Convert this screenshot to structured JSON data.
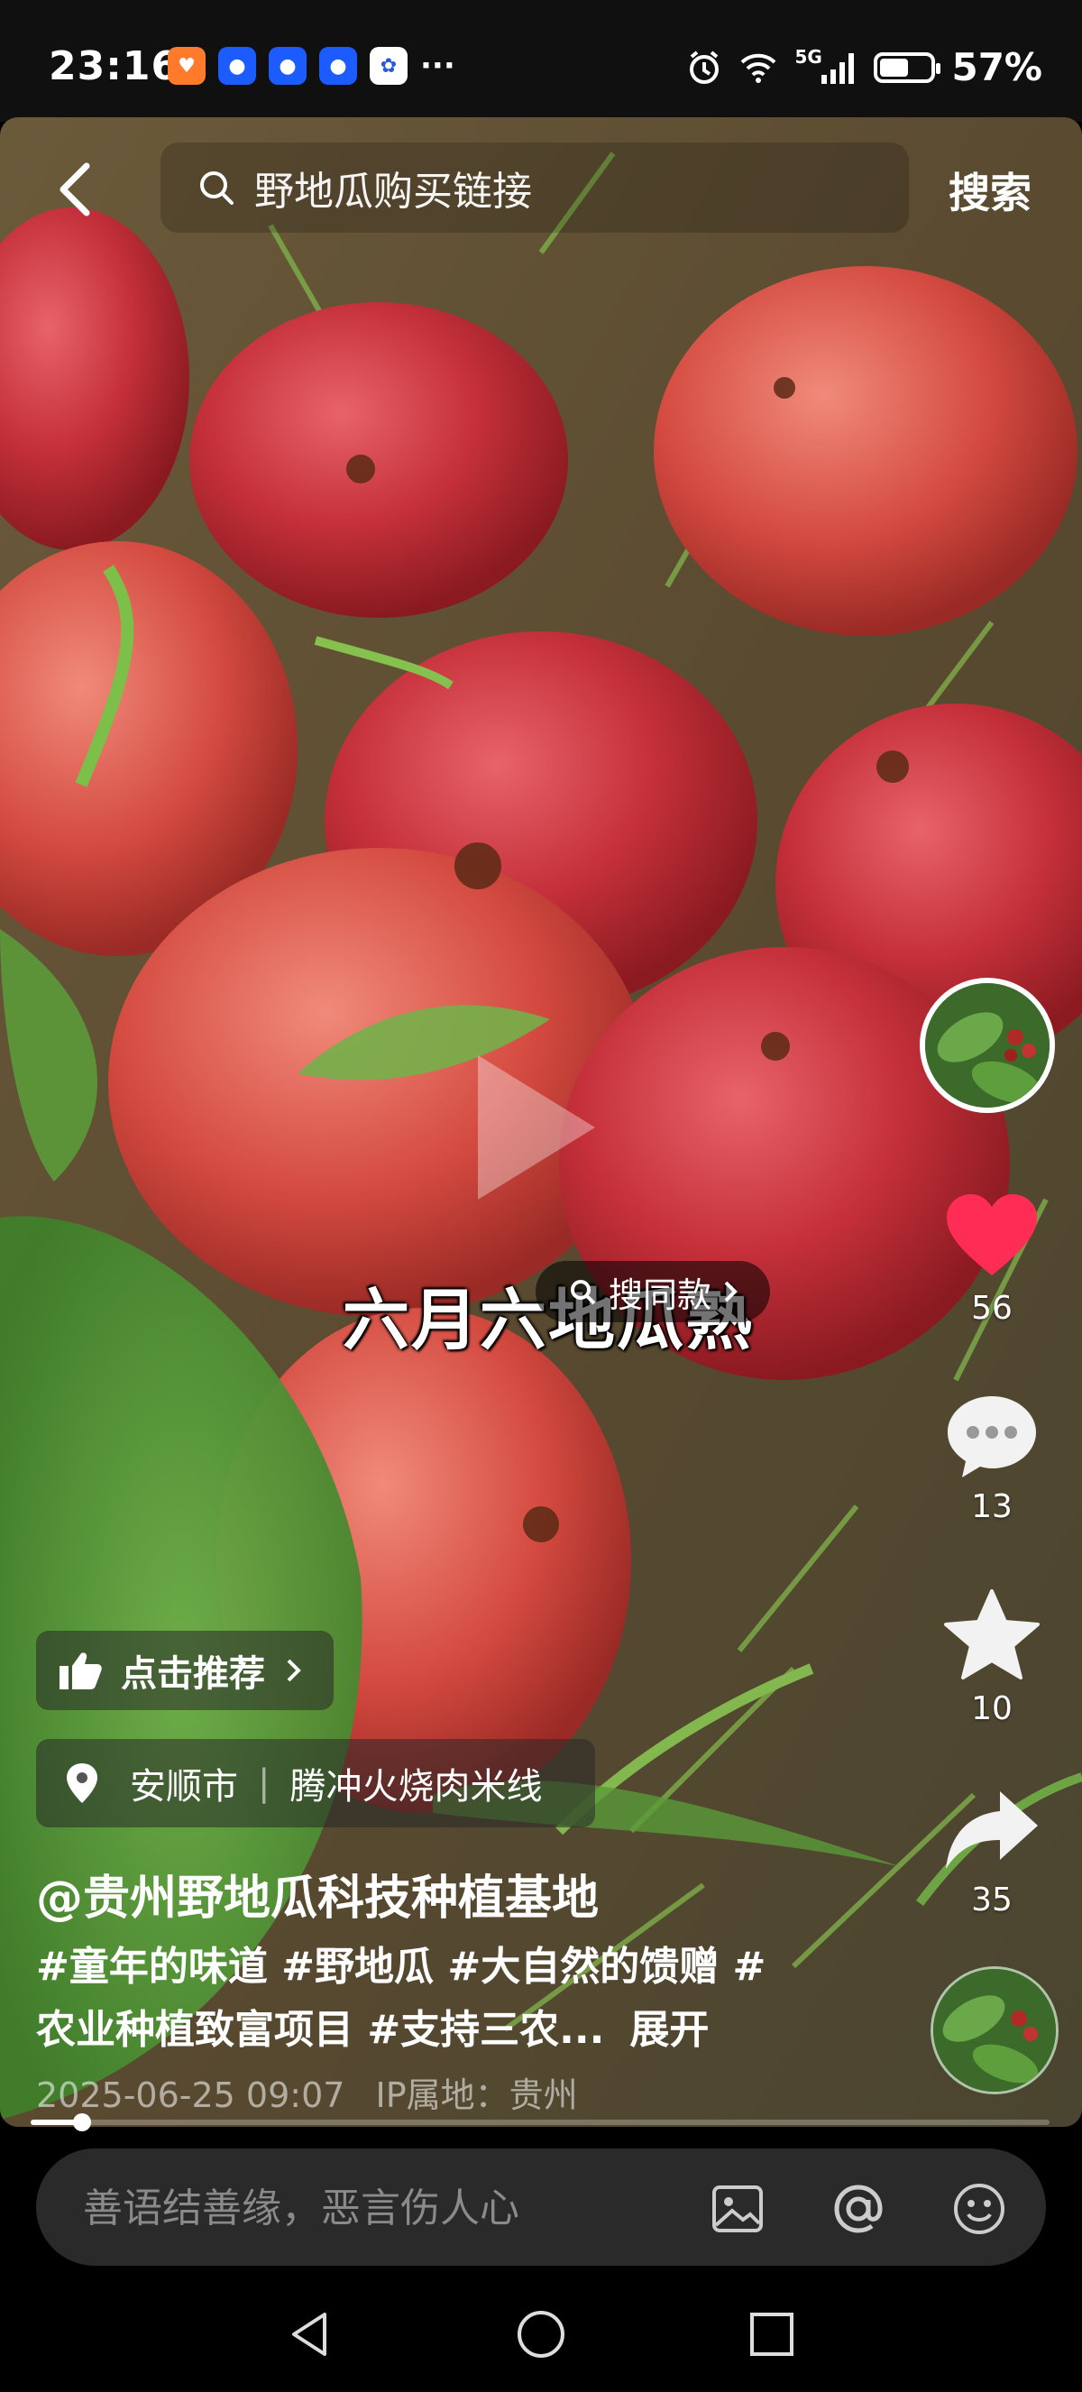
{
  "status_bar": {
    "time": "23:16",
    "signal_label": "5G",
    "battery_percent": "57%",
    "battery_level": 0.57,
    "app_icons": [
      "taobao-icon",
      "app-icon",
      "app-icon",
      "app-icon",
      "baidu-icon"
    ],
    "more": "···"
  },
  "header": {
    "search_placeholder": "野地瓜购买链接",
    "search_button": "搜索"
  },
  "video": {
    "caption": "六月六地瓜熟",
    "same_style_label": "搜同款",
    "progress": 0.05
  },
  "side_actions": {
    "likes": "56",
    "comments": "13",
    "favorites": "10",
    "shares": "35"
  },
  "recommend_label": "点击推荐",
  "location": {
    "city": "安顺市",
    "place": "腾冲火烧肉米线"
  },
  "post": {
    "author": "@贵州野地瓜科技种植基地",
    "description_line1": "#童年的味道 #野地瓜 #大自然的馈赠 #",
    "description_line2": "农业种植致富项目 #支持三农...",
    "expand_label": "展开",
    "timestamp": "2025-06-25 09:07",
    "ip_location": "IP属地：贵州"
  },
  "comment_bar": {
    "placeholder": "善语结善缘，恶言伤人心"
  },
  "colors": {
    "like_red": "#ff2d55",
    "background": "#000000"
  }
}
